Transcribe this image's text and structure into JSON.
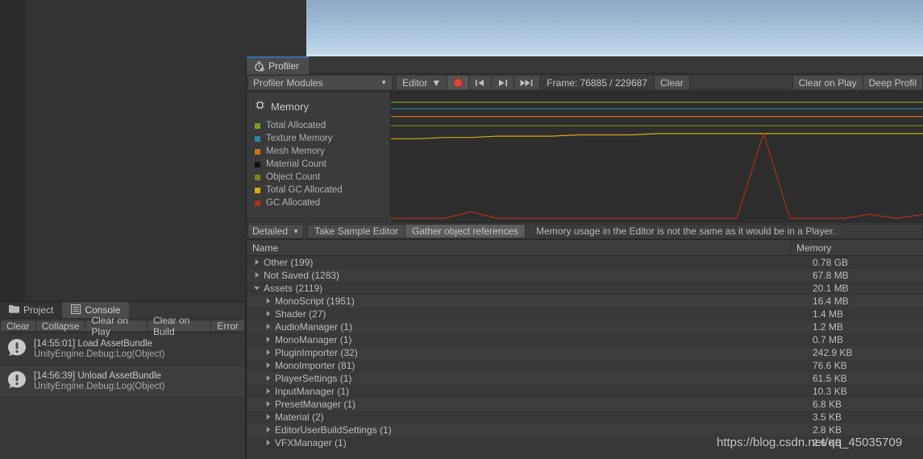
{
  "window": {
    "tab_label": "Profiler",
    "tab_icon": "stopwatch-icon"
  },
  "toolbar": {
    "modules_label": "Profiler Modules",
    "target_label": "Editor",
    "record_icon": "record-icon",
    "prev_frame_icon": "skip-to-start-icon",
    "next_frame_icon": "step-forward-icon",
    "last_frame_icon": "skip-to-end-icon",
    "frame_label": "Frame: 76885 / 229687",
    "clear_label": "Clear",
    "clear_on_play_label": "Clear on Play",
    "deep_profile_label": "Deep Profil"
  },
  "legend": {
    "title": "Memory",
    "title_icon": "chip-icon",
    "items": [
      {
        "label": "Total Allocated",
        "color": "#7d9b28"
      },
      {
        "label": "Texture Memory",
        "color": "#2e84a8"
      },
      {
        "label": "Mesh Memory",
        "color": "#cf7116"
      },
      {
        "label": "Material Count",
        "color": "#121212"
      },
      {
        "label": "Object Count",
        "color": "#84801e"
      },
      {
        "label": "Total GC Allocated",
        "color": "#d1ac14"
      },
      {
        "label": "GC Allocated",
        "color": "#a8331a"
      }
    ]
  },
  "chart_data": {
    "type": "line",
    "title": "Memory",
    "xlabel": "",
    "ylabel": "",
    "grid": false,
    "legend_position": "left",
    "x": [
      0,
      5,
      10,
      15,
      20,
      25,
      30,
      35,
      40,
      45,
      50,
      55,
      60,
      65,
      70,
      75,
      80,
      85,
      90,
      95,
      100
    ],
    "series": [
      {
        "name": "Total Allocated",
        "color": "#7d9b28",
        "values": [
          92,
          92,
          92,
          92,
          92,
          92,
          92,
          92,
          92,
          92,
          92,
          92,
          92,
          92,
          92,
          92,
          92,
          92,
          92,
          92,
          92
        ]
      },
      {
        "name": "Texture Memory",
        "color": "#2e84a8",
        "values": [
          87,
          87,
          87,
          87,
          87,
          87,
          87,
          87,
          87,
          87,
          87,
          87,
          87,
          87,
          87,
          87,
          87,
          87,
          87,
          87,
          87
        ]
      },
      {
        "name": "Mesh Memory",
        "color": "#cf7116",
        "values": [
          81,
          81,
          81,
          81,
          81,
          81,
          81,
          81,
          81,
          81,
          81,
          81,
          81,
          81,
          81,
          81,
          81,
          81,
          81,
          81,
          81
        ]
      },
      {
        "name": "Material Count",
        "color": "#121212",
        "values": [
          0,
          0,
          0,
          0,
          0,
          0,
          0,
          0,
          0,
          0,
          0,
          0,
          0,
          0,
          0,
          0,
          0,
          0,
          0,
          0,
          0
        ]
      },
      {
        "name": "Object Count",
        "color": "#84801e",
        "values": [
          74,
          74,
          74,
          74,
          74,
          74,
          74,
          74,
          74,
          74,
          74,
          74,
          74,
          74,
          74,
          74,
          74,
          74,
          74,
          74,
          74
        ]
      },
      {
        "name": "Total GC Allocated",
        "color": "#d1ac14",
        "values": [
          64,
          64,
          65,
          65,
          66,
          66,
          66,
          67,
          67,
          67,
          68,
          68,
          68,
          68,
          68,
          68,
          68,
          68,
          68,
          68,
          68
        ]
      },
      {
        "name": "GC Allocated",
        "color": "#a8331a",
        "values": [
          3,
          3,
          3,
          8,
          3,
          3,
          3,
          3,
          3,
          3,
          3,
          3,
          3,
          3,
          68,
          3,
          3,
          3,
          6,
          3,
          6
        ]
      }
    ],
    "ylim": [
      0,
      100
    ]
  },
  "detail_toolbar": {
    "view_label": "Detailed",
    "take_sample_label": "Take Sample Editor",
    "gather_refs_label": "Gather object references",
    "note_label": "Memory usage in the Editor is not the same as it would be in a Player."
  },
  "table": {
    "columns": [
      "Name",
      "Memory"
    ],
    "rows": [
      {
        "name": "Other (199)",
        "memory": "0.78 GB",
        "depth": 0,
        "expanded": false
      },
      {
        "name": "Not Saved (1283)",
        "memory": "67.8 MB",
        "depth": 0,
        "expanded": false
      },
      {
        "name": "Assets (2119)",
        "memory": "20.1 MB",
        "depth": 0,
        "expanded": true
      },
      {
        "name": "MonoScript (1951)",
        "memory": "16.4 MB",
        "depth": 1,
        "expanded": false
      },
      {
        "name": "Shader (27)",
        "memory": "1.4 MB",
        "depth": 1,
        "expanded": false
      },
      {
        "name": "AudioManager (1)",
        "memory": "1.2 MB",
        "depth": 1,
        "expanded": false
      },
      {
        "name": "MonoManager (1)",
        "memory": "0.7 MB",
        "depth": 1,
        "expanded": false
      },
      {
        "name": "PluginImporter (32)",
        "memory": "242.9 KB",
        "depth": 1,
        "expanded": false
      },
      {
        "name": "MonoImporter (81)",
        "memory": "76.6 KB",
        "depth": 1,
        "expanded": false
      },
      {
        "name": "PlayerSettings (1)",
        "memory": "61.5 KB",
        "depth": 1,
        "expanded": false
      },
      {
        "name": "InputManager (1)",
        "memory": "10.3 KB",
        "depth": 1,
        "expanded": false
      },
      {
        "name": "PresetManager (1)",
        "memory": "6.8 KB",
        "depth": 1,
        "expanded": false
      },
      {
        "name": "Material (2)",
        "memory": "3.5 KB",
        "depth": 1,
        "expanded": false
      },
      {
        "name": "EditorUserBuildSettings (1)",
        "memory": "2.8 KB",
        "depth": 1,
        "expanded": false
      },
      {
        "name": "VFXManager (1)",
        "memory": "2.6 KB",
        "depth": 1,
        "expanded": false
      }
    ]
  },
  "console": {
    "tabs": [
      {
        "label": "Project",
        "icon": "folder-icon",
        "active": false
      },
      {
        "label": "Console",
        "icon": "console-icon",
        "active": true
      }
    ],
    "buttons": [
      "Clear",
      "Collapse",
      "Clear on Play",
      "Clear on Build",
      "Error"
    ],
    "messages": [
      {
        "icon": "info-icon",
        "line1": "[14:55:01] Load AssetBundle",
        "line2": "UnityEngine.Debug:Log(Object)"
      },
      {
        "icon": "info-icon",
        "line1": "[14:56:39] Unload AssetBundle",
        "line2": "UnityEngine.Debug:Log(Object)"
      }
    ]
  },
  "watermark": {
    "text": "https://blog.csdn.net/qq_45035709"
  }
}
